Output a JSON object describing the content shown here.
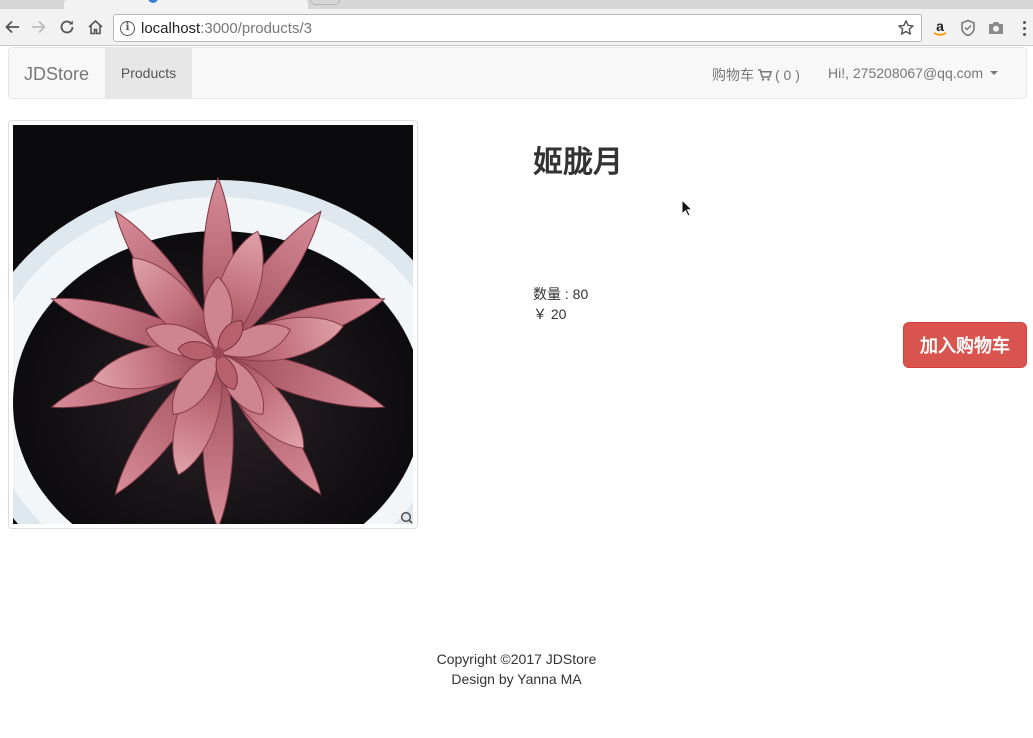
{
  "browser": {
    "url_host": "localhost",
    "url_path": ":3000/products/3",
    "icons": [
      "back-arrow-icon",
      "forward-arrow-icon",
      "reload-icon",
      "home-icon",
      "info-icon",
      "bookmark-star-icon",
      "amazon-extension-icon",
      "shield-extension-icon",
      "camera-extension-icon",
      "menu-dots-icon"
    ]
  },
  "navbar": {
    "brand": "JDStore",
    "products_label": "Products",
    "cart_label": "购物车",
    "cart_count": "( 0 )",
    "user_label": "Hi!, 275208067@qq.com"
  },
  "product": {
    "title": "姬胧月",
    "quantity": "数量 : 80",
    "price": "￥ 20",
    "add_to_cart": "加入购物车",
    "image_subject": "pink succulent in white pot"
  },
  "footer": {
    "copyright": "Copyright ©2017 JDStore",
    "credit": "Design by Yanna MA"
  },
  "colors": {
    "accent_button": "#d9534f",
    "navbar_bg": "#f8f8f8",
    "active_nav_bg": "#e7e7e7"
  }
}
